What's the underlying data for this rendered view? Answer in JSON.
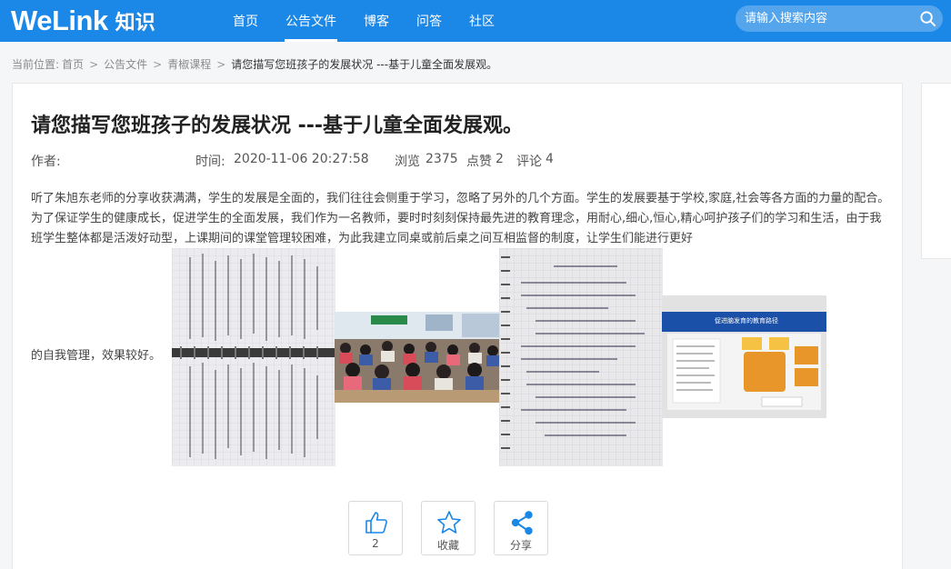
{
  "app": {
    "brand": "WeLink",
    "product": "知识"
  },
  "nav": [
    {
      "label": "首页",
      "active": false
    },
    {
      "label": "公告文件",
      "active": true
    },
    {
      "label": "博客",
      "active": false
    },
    {
      "label": "问答",
      "active": false
    },
    {
      "label": "社区",
      "active": false
    }
  ],
  "search": {
    "placeholder": "请输入搜索内容",
    "icon": "search-icon"
  },
  "breadcrumb": {
    "prefix": "当前位置:",
    "items": [
      "首页",
      "公告文件",
      "青椒课程"
    ],
    "current": "请您描写您班孩子的发展状况 ---基于儿童全面发展观。",
    "separator": ">"
  },
  "article": {
    "title": "请您描写您班孩子的发展状况 ---基于儿童全面发展观。",
    "author_label": "作者:",
    "author": "",
    "time_label": "时间:",
    "time": "2020-11-06 20:27:58",
    "views_label": "浏览",
    "views": "2375",
    "likes_label": "点赞",
    "likes": "2",
    "comments_label": "评论",
    "comments": "4",
    "body": "听了朱旭东老师的分享收获满满，学生的发展是全面的，我们往往会侧重于学习，忽略了另外的几个方面。学生的发展要基于学校,家庭,社会等各方面的力量的配合。为了保证学生的健康成长，促进学生的全面发展，我们作为一名教师，要时时刻刻保持最先进的教育理念，用耐心,细心,恒心,精心呵护孩子们的学习和生活，由于我班学生整体都是活泼好动型，上课期间的课堂管理较困难，为此我建立同桌或前后桌之间互相监督的制度，让学生们能进行更好",
    "tail": "的自我管理，效果较好。"
  },
  "slide": {
    "title": "促进脑发育的教育路径"
  },
  "actions": [
    {
      "label": "2",
      "icon": "thumbs-up-icon"
    },
    {
      "label": "收藏",
      "icon": "star-icon"
    },
    {
      "label": "分享",
      "icon": "share-icon"
    }
  ],
  "colors": {
    "header": "#1b87e6",
    "accent": "#1b87e6"
  }
}
